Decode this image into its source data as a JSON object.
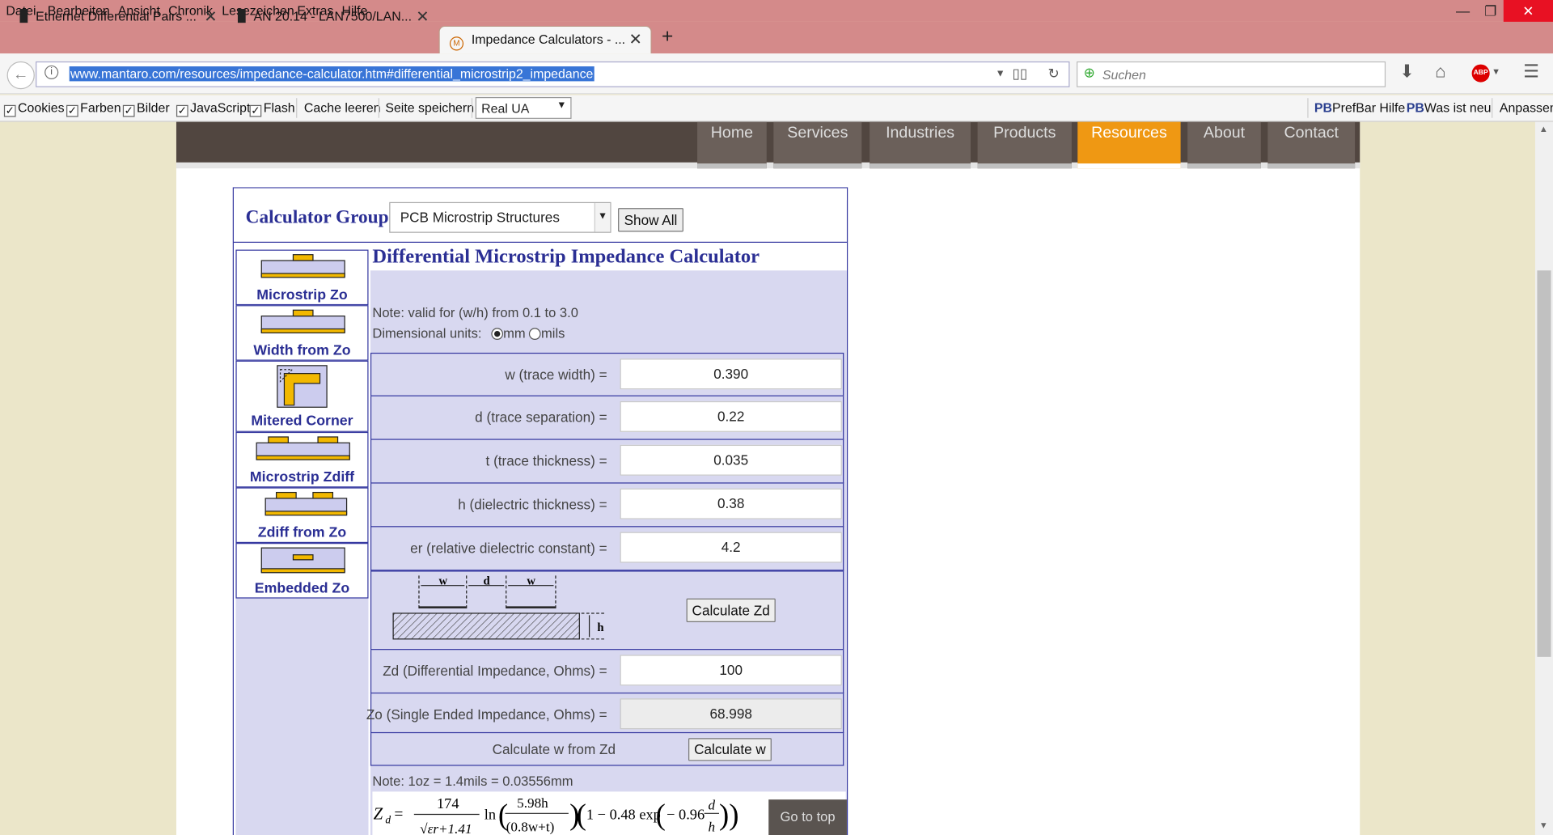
{
  "menubar": [
    "Datei",
    "Bearbeiten",
    "Ansicht",
    "Chronik",
    "Lesezeichen",
    "Extras",
    "Hilfe"
  ],
  "window_controls": {
    "minimize": "—",
    "maximize": "❐",
    "close": "✕"
  },
  "tabs": [
    {
      "title": "Ethernet Differential Pairs ..."
    },
    {
      "title": "AN 20.14 - LAN7500/LAN..."
    },
    {
      "title": "Impedance Calculators - ..."
    }
  ],
  "new_tab": "+",
  "url": "www.mantaro.com/resources/impedance-calculator.htm#differential_microstrip2_impedance",
  "search_placeholder": "Suchen",
  "prefbar": {
    "cookies": "Cookies",
    "farben": "Farben",
    "bilder": "Bilder",
    "javascript": "JavaScript",
    "flash": "Flash",
    "cache": "Cache leeren",
    "save": "Seite speichern",
    "ua_select": "Real UA",
    "pb": "PB",
    "prefbar_help": "PrefBar Hilfe",
    "whats_new": "Was ist neu",
    "customize": "Anpassen",
    "abp": "ABP"
  },
  "site_nav": [
    "Home",
    "Services",
    "Industries",
    "Products",
    "Resources",
    "About",
    "Contact"
  ],
  "calc_group_label": "Calculator Group:",
  "calc_group_value": "PCB Microstrip Structures",
  "show_all": "Show All",
  "sidebar": [
    "Microstrip Zo",
    "Width from Zo",
    "Mitered Corner",
    "Microstrip Zdiff",
    "Zdiff from Zo",
    "Embedded Zo"
  ],
  "title": "Differential Microstrip Impedance Calculator",
  "note_valid": "Note: valid for (w/h) from 0.1 to 3.0",
  "units_label": "Dimensional units:",
  "unit_mm": "mm",
  "unit_mils": "mils",
  "fields": [
    {
      "label": "w (trace width) =",
      "value": "0.390"
    },
    {
      "label": "d (trace separation) =",
      "value": "0.22"
    },
    {
      "label": "t (trace thickness) =",
      "value": "0.035"
    },
    {
      "label": "h (dielectric thickness) =",
      "value": "0.38"
    },
    {
      "label": "er (relative dielectric constant) =",
      "value": "4.2"
    }
  ],
  "diagram": {
    "w": "w",
    "d": "d",
    "h": "h"
  },
  "calculate_zd": "Calculate Zd",
  "zd": {
    "label": "Zd (Differential Impedance, Ohms) =",
    "value": "100"
  },
  "zo": {
    "label": "Zo (Single Ended Impedance, Ohms) =",
    "value": "68.998"
  },
  "calc_w_label": "Calculate w from Zd",
  "calc_w_button": "Calculate w",
  "note_oz": "Note: 1oz = 1.4mils = 0.03556mm",
  "formula": {
    "zd": "Z",
    "sub": "d",
    "eq": "=",
    "num": "174",
    "ln": "ln",
    "num2": "5.98h",
    "den2": "(0.8w+t)",
    "rest": "1 − 0.48 exp",
    "rest2": "− 0.96",
    "frac_d": "d",
    "frac_h": "h"
  },
  "go_to_top": "Go to top"
}
